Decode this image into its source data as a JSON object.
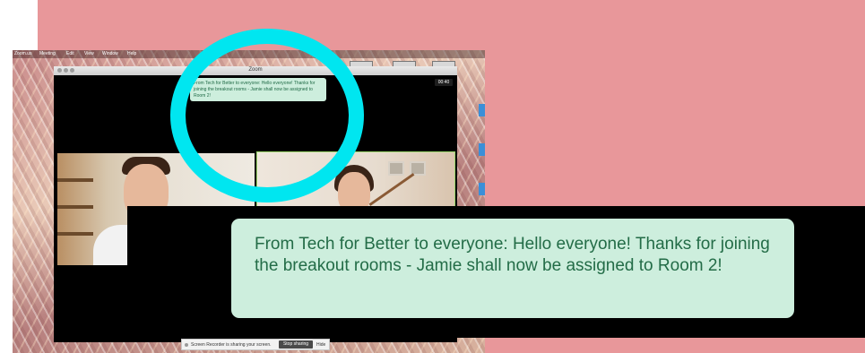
{
  "menubar": {
    "items": [
      "Zoom.us",
      "Meeting",
      "Edit",
      "View",
      "Window",
      "Help"
    ]
  },
  "window": {
    "title": "Zoom",
    "timer": "00:40"
  },
  "chat": {
    "message": "From Tech for Better to everyone: Hello everyone! Thanks for joining the breakout rooms - Jamie shall now be assigned to Room 2!"
  },
  "share_bar": {
    "message": "Screen Recorder is sharing your screen.",
    "stop_label": "Stop sharing",
    "hide_label": "Hide"
  },
  "colors": {
    "page_background": "#e8979a",
    "highlight_ring": "#00e6f0",
    "chat_bubble": "#cdeedd",
    "chat_text": "#236c47",
    "active_speaker_border": "#9bd66b"
  },
  "icons": [
    "window-close-icon",
    "window-minimize-icon",
    "window-zoom-icon",
    "recording-icon"
  ]
}
